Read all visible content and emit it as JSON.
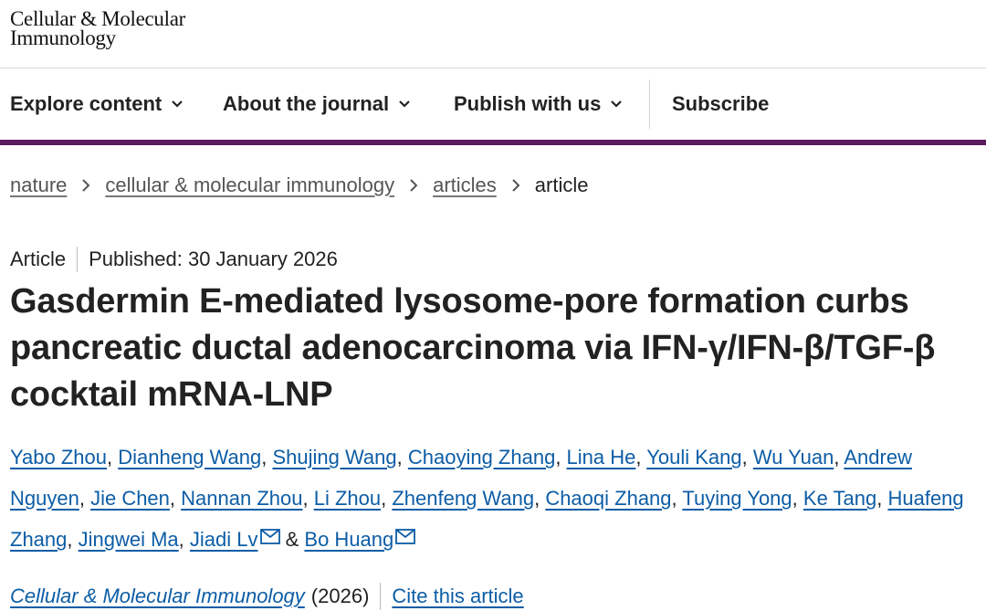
{
  "header": {
    "logo_line1": "Cellular & Molecular",
    "logo_line2": "Immunology"
  },
  "nav": {
    "explore": "Explore content",
    "about": "About the journal",
    "publish": "Publish with us",
    "subscribe": "Subscribe"
  },
  "breadcrumb": {
    "items": [
      "nature",
      "cellular & molecular immunology",
      "articles"
    ],
    "current": "article"
  },
  "article": {
    "type": "Article",
    "published": "Published: 30 January 2026",
    "title": "Gasdermin E-mediated lysosome-pore formation curbs pancreatic ductal adenocarcinoma via IFN-γ/IFN-β/TGF-β cocktail mRNA-LNP",
    "authors": [
      "Yabo Zhou",
      "Dianheng Wang",
      "Shujing Wang",
      "Chaoying Zhang",
      "Lina He",
      "Youli Kang",
      "Wu Yuan",
      "Andrew Nguyen",
      "Jie Chen",
      "Nannan Zhou",
      "Li Zhou",
      "Zhenfeng Wang",
      "Chaoqi Zhang",
      "Tuying Yong",
      "Ke Tang",
      "Huafeng Zhang",
      "Jingwei Ma",
      "Jiadi Lv",
      "Bo Huang"
    ],
    "ampersand": "&",
    "journal": "Cellular & Molecular Immunology",
    "year": "(2026)",
    "cite": "Cite this article"
  },
  "colors": {
    "accent_bar": "#5b1b5d",
    "link": "#0d5da6"
  },
  "icons": [
    "chevron-down-icon",
    "chevron-right-icon",
    "mail-icon"
  ]
}
